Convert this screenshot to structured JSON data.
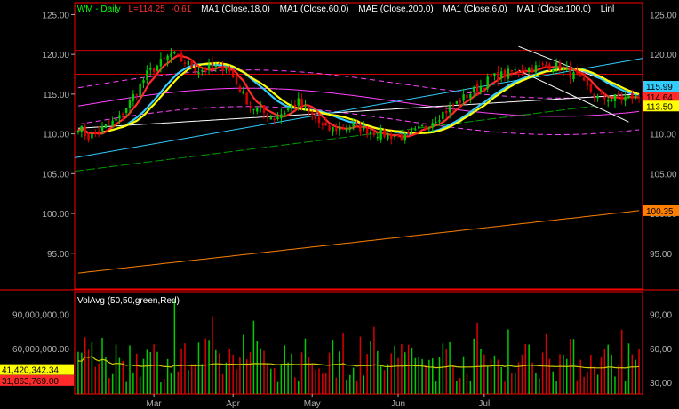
{
  "header": {
    "symbol": "IWM - Daily",
    "last": "L=114.25",
    "change": "-0.61",
    "studies": [
      "MA1 (Close,18,0)",
      "MA1 (Close,60,0)",
      "MAE (Close,200,0)",
      "MA1 (Close,6,0)",
      "MA1 (Close,100,0)",
      "Linl"
    ]
  },
  "volume_header": "VolAvg (50,50,green,Red)",
  "colors": {
    "background": "#000000",
    "frame": "#ff0000",
    "header_green": "#00ff00",
    "header_red": "#ff3333",
    "tick_text": "#b0b0b0",
    "up_bar": "#00cc00",
    "down_bar": "#dd0000",
    "ma6": "#ff2a2a",
    "ma18": "#ffff00",
    "ma60": "#33ccff",
    "ma100": "#ffffff",
    "ma200": "#ff8000",
    "mae_band": "#ff44ff",
    "trend_green": "#009900",
    "vol_avg": "#cccc00"
  },
  "chart_data": [
    {
      "type": "candlestick",
      "title": "IWM - Daily",
      "x_tick_labels": [
        "Mar",
        "Apr",
        "May",
        "Jun",
        "Jul"
      ],
      "y_tick_labels": [
        "95.00",
        "100.00",
        "105.00",
        "110.00",
        "115.00",
        "120.00",
        "125.00"
      ],
      "ylim": [
        90.5,
        126.5
      ],
      "price_markers": [
        {
          "value": 115.99,
          "label": "115.99",
          "color": "#33ccff"
        },
        {
          "value": 114.64,
          "label": "114.64",
          "color": "#ff2a2a"
        },
        {
          "value": 113.5,
          "label": "113.50",
          "color": "#ffff00"
        },
        {
          "value": 100.35,
          "label": "100.35",
          "color": "#ff8000"
        }
      ],
      "horizontal_lines": [
        120.5,
        117.5
      ],
      "anchors": {
        "close": [
          [
            0,
            111
          ],
          [
            3,
            109.5
          ],
          [
            12,
            112
          ],
          [
            20,
            117.5
          ],
          [
            27,
            120
          ],
          [
            35,
            118
          ],
          [
            43,
            118.5
          ],
          [
            50,
            113.5
          ],
          [
            57,
            112
          ],
          [
            64,
            114
          ],
          [
            72,
            110.5
          ],
          [
            80,
            111
          ],
          [
            88,
            110
          ],
          [
            96,
            109.5
          ],
          [
            104,
            112
          ],
          [
            112,
            114.5
          ],
          [
            120,
            117
          ],
          [
            128,
            118
          ],
          [
            136,
            118.5
          ],
          [
            140,
            118.5
          ],
          [
            145,
            117
          ],
          [
            151,
            114.5
          ],
          [
            157,
            114.5
          ],
          [
            163,
            114.6
          ]
        ],
        "ma200_start": 92.5,
        "ma200_end": 100.35,
        "ma100_start": 110.7,
        "ma100_end": 115.0,
        "mae_center": 115,
        "mae_band": 2.3
      },
      "series_colors": {
        "ma6": "#ff2a2a",
        "ma18": "#ffff00",
        "ma60": "#33ccff",
        "ma100": "#ffffff",
        "ma200": "#ff8000"
      }
    },
    {
      "type": "bar",
      "title": "VolAvg (50,50,green,Red)",
      "y_tick_labels": [
        "30,00",
        "60,00",
        "90,00"
      ],
      "ylim": [
        20000000,
        110000000
      ],
      "left_labels": [
        "90,000,000.00",
        "60,000,000.00"
      ],
      "value_markers": [
        {
          "value": 41420342.34,
          "label": "41,420,342.34",
          "color": "#ffff00"
        },
        {
          "value": 31863769,
          "label": "31,863,769.00",
          "color": "#ff2a2a"
        }
      ],
      "series": [
        {
          "name": "VolAvg",
          "period": 50
        }
      ]
    }
  ]
}
